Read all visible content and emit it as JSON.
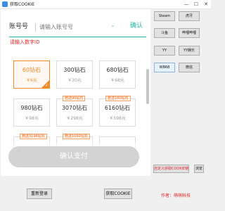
{
  "window": {
    "title": "获取COOKIE",
    "controls": {
      "minimize": "—",
      "maximize": "☐",
      "close": "✕"
    }
  },
  "login": {
    "label": "账号号",
    "placeholder": "请输入账号号",
    "chevron": "⌄",
    "confirm": "确认",
    "hint": "请输入数字ID"
  },
  "packages": [
    {
      "amount": "60钻石",
      "price": "￥6元",
      "badge": "",
      "selected": true
    },
    {
      "amount": "300钻石",
      "price": "￥30元",
      "badge": "",
      "selected": false
    },
    {
      "amount": "680钻石",
      "price": "￥68元",
      "badge": "",
      "selected": false
    },
    {
      "amount": "980钻石",
      "price": "￥98元",
      "badge": "",
      "selected": false
    },
    {
      "amount": "3070钻石",
      "price": "￥298元",
      "badge": "赠送90钻石",
      "selected": false
    },
    {
      "amount": "6160钻石",
      "price": "￥598元",
      "badge": "赠送180钻石",
      "selected": false
    },
    {
      "amount": "",
      "price": "",
      "badge": "赠送3196钻石",
      "selected": false
    },
    {
      "amount": "",
      "price": "",
      "badge": "赠送1090钻石",
      "selected": false
    }
  ],
  "pay_button": "确认支付",
  "side_buttons": [
    {
      "label": "Steam",
      "active": false
    },
    {
      "label": "虎牙",
      "active": false
    },
    {
      "label": "斗鱼",
      "active": false
    },
    {
      "label": "哔哩哔哩",
      "active": false
    },
    {
      "label": "YY",
      "active": false
    },
    {
      "label": "YY娱乐",
      "active": false
    },
    {
      "label": "WB68",
      "active": true
    },
    {
      "label": "微信",
      "active": false
    }
  ],
  "custom_button": "自定义获取COOKIE链接",
  "browse_button": "浏览",
  "author": "作者：萌萌科技",
  "bottom_buttons": {
    "reload": "重新登录",
    "get_cookie": "获取COOKIE"
  },
  "colors": {
    "accent": "#25b3a6",
    "selected": "#f28a2a",
    "warning": "#e0262c"
  }
}
